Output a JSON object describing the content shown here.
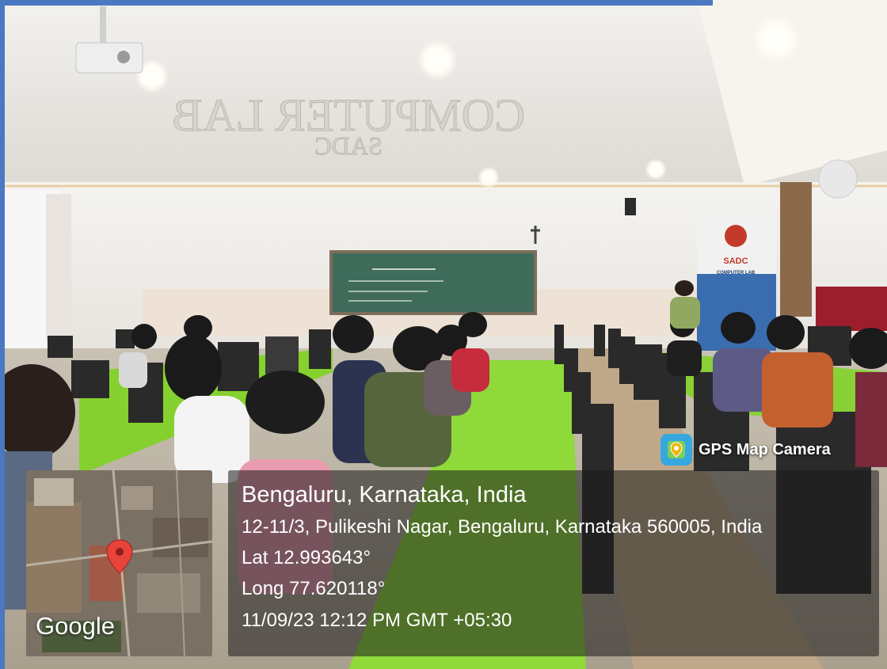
{
  "ceiling_sign": "COMPUTER LAB",
  "ceiling_sign_sub": "SADC",
  "banner": {
    "logo_text": "SADC",
    "caption": "COMPUTER LAB"
  },
  "overlay": {
    "app_badge": "GPS Map Camera",
    "app_icon": "map-pin-icon",
    "map_provider": "Google",
    "location_title": "Bengaluru, Karnataka, India",
    "address": "12-11/3, Pulikeshi Nagar, Bengaluru, Karnataka 560005, India",
    "latitude": "Lat 12.993643°",
    "longitude": "Long 77.620118°",
    "timestamp": "11/09/23 12:12 PM GMT +05:30"
  },
  "colors": {
    "frame_accent": "#4a78c2",
    "desk_green": "#7ed321",
    "pin_red": "#e8433a",
    "chalkboard": "#3f6b5b"
  }
}
